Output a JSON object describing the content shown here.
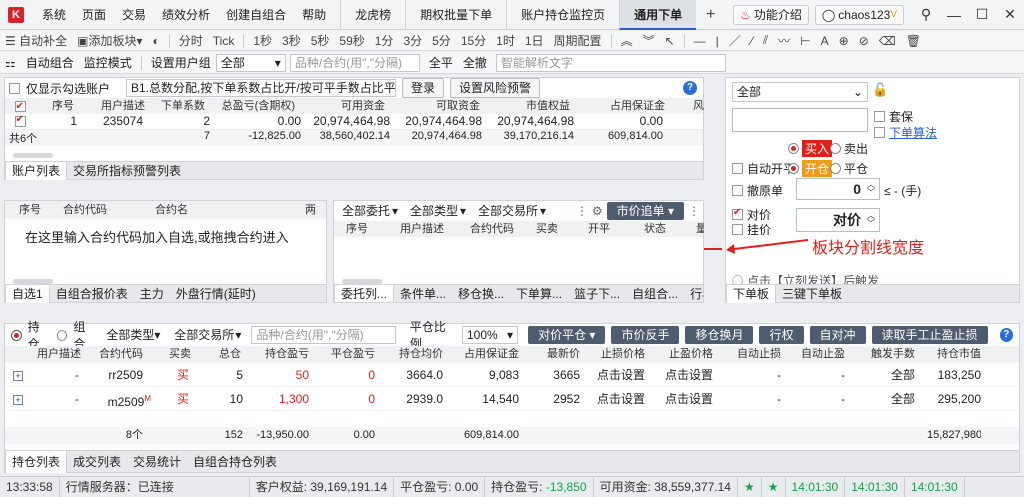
{
  "menubar": {
    "logo": "K",
    "items": [
      "系统",
      "页面",
      "交易",
      "绩效分析",
      "创建自组合",
      "帮助"
    ],
    "tabs": [
      "龙虎榜",
      "期权批量下单",
      "账户持仓监控页",
      "通用下单"
    ],
    "active_tab": "通用下单",
    "feature_intro": "功能介绍",
    "user": "chaos123",
    "user_badge": "V"
  },
  "toolbar": {
    "items": [
      "自动补全",
      "添加板块",
      "分时",
      "Tick",
      "1秒",
      "3秒",
      "5秒",
      "59秒",
      "1分",
      "3分",
      "5分",
      "15分",
      "1时",
      "1日",
      "周期配置"
    ]
  },
  "toolbar2": {
    "auto_group": "自动组合",
    "monitor_mode": "监控模式",
    "user_group_label": "设置用户组",
    "user_group_value": "全部",
    "product_placeholder": "品种/合约(用\",\"分隔)",
    "full": "全平",
    "withdraw": "全撤",
    "smart_placeholder": "智能解析文字"
  },
  "accounts": {
    "only_show_checked": "仅显示勾选账户",
    "alloc_value": "B1.总数分配,按下单系数占比开/按可平手数占比平",
    "login": "登录",
    "risk_button": "设置风险预警",
    "headers": [
      "序号",
      "用户描述",
      "下单系数",
      "总盈亏(含期权)",
      "可用资金",
      "可取资金",
      "市值权益",
      "占用保证金",
      "风"
    ],
    "rows": [
      [
        "1",
        "235074",
        "2",
        "0.00",
        "20,974,464.98",
        "20,974,464.98",
        "20,974,464.98",
        "0.00"
      ]
    ],
    "summary": [
      "共6个",
      "7",
      "-12,825.00",
      "38,560,402.14",
      "20,974,464.98",
      "39,170,216.14",
      "609,814.00"
    ],
    "tabs": [
      "账户列表",
      "交易所指标预警列表"
    ]
  },
  "watchlist": {
    "headers": [
      "序号",
      "合约代码",
      "合约名",
      "两"
    ],
    "hint": "在这里输入合约代码加入自选,或拖拽合约进入",
    "tabs": [
      "自选1",
      "自组合报价表",
      "主力",
      "外盘行情(延时)"
    ]
  },
  "orders": {
    "filter_all": "全部委托",
    "filter_type": "全部类型",
    "filter_exchange": "全部交易所",
    "market_chase": "市价追单",
    "headers": [
      "序号",
      "用户描述",
      "合约代码",
      "买卖",
      "开平",
      "状态",
      "量"
    ],
    "tabs": [
      "委托列...",
      "条件单...",
      "移仓换...",
      "下单算...",
      "篮子下...",
      "自组合...",
      "行权委..."
    ]
  },
  "order_panel": {
    "account_select": "全部",
    "hedge": "套保",
    "algo": "下单算法",
    "buy": "买入",
    "sell": "卖出",
    "auto_open_close": "自动开平",
    "open": "开仓",
    "close": "平仓",
    "cancel_order": "撤原单",
    "qty": "0",
    "qty_unit": "≤ - (手)",
    "counter_price": "对价",
    "hang_price": "挂价",
    "price_value": "对价",
    "annotation": "板块分割线宽度",
    "quick_send": "点击【立刻发送】后触发",
    "tabs": [
      "下单板",
      "三键下单板"
    ]
  },
  "positions": {
    "mode_position": "持仓",
    "mode_combo": "组合",
    "type_filter": "全部类型",
    "exchange_filter": "全部交易所",
    "product_placeholder": "品种/合约(用\",\"分隔)",
    "ratio_label": "平仓比例",
    "ratio_value": "100%",
    "buttons": [
      "对价平仓",
      "市价反手",
      "移仓换月",
      "行权",
      "自对冲",
      "读取手工止盈止损"
    ],
    "headers": [
      "用户描述",
      "合约代码",
      "买卖",
      "总仓",
      "持仓盈亏",
      "平仓盈亏",
      "持仓均价",
      "占用保证金",
      "最新价",
      "止损价格",
      "止盈价格",
      "自动止损",
      "自动止盈",
      "触发手数",
      "持仓市值"
    ],
    "rows": [
      [
        "-",
        "rr2509",
        "买",
        "5",
        "50",
        "0",
        "3664.0",
        "9,083",
        "3665",
        "点击设置",
        "点击设置",
        "-",
        "-",
        "全部",
        "183,250"
      ],
      [
        "-",
        "m2509",
        "买",
        "10",
        "1,300",
        "0",
        "2939.0",
        "14,540",
        "2952",
        "点击设置",
        "点击设置",
        "-",
        "-",
        "全部",
        "295,200"
      ]
    ],
    "m_badge": "M",
    "summary": [
      "8个",
      "152",
      "-13,950.00",
      "0.00",
      "609,814.00",
      "15,827,980"
    ],
    "tabs": [
      "持仓列表",
      "成交列表",
      "交易统计",
      "自组合持仓列表"
    ]
  },
  "statusbar": {
    "time": "13:33:58",
    "server": "行情服务器：已连接",
    "equity": "客户权益: 39,169,191.14",
    "close_pnl": "平仓盈亏: 0.00",
    "pos_pnl_label": "持仓盈亏:",
    "pos_pnl_value": "-13,850",
    "available": "可用资金: 38,559,377.14",
    "t1": "14:01:30",
    "t2": "14:01:30",
    "t3": "14:01:30"
  }
}
